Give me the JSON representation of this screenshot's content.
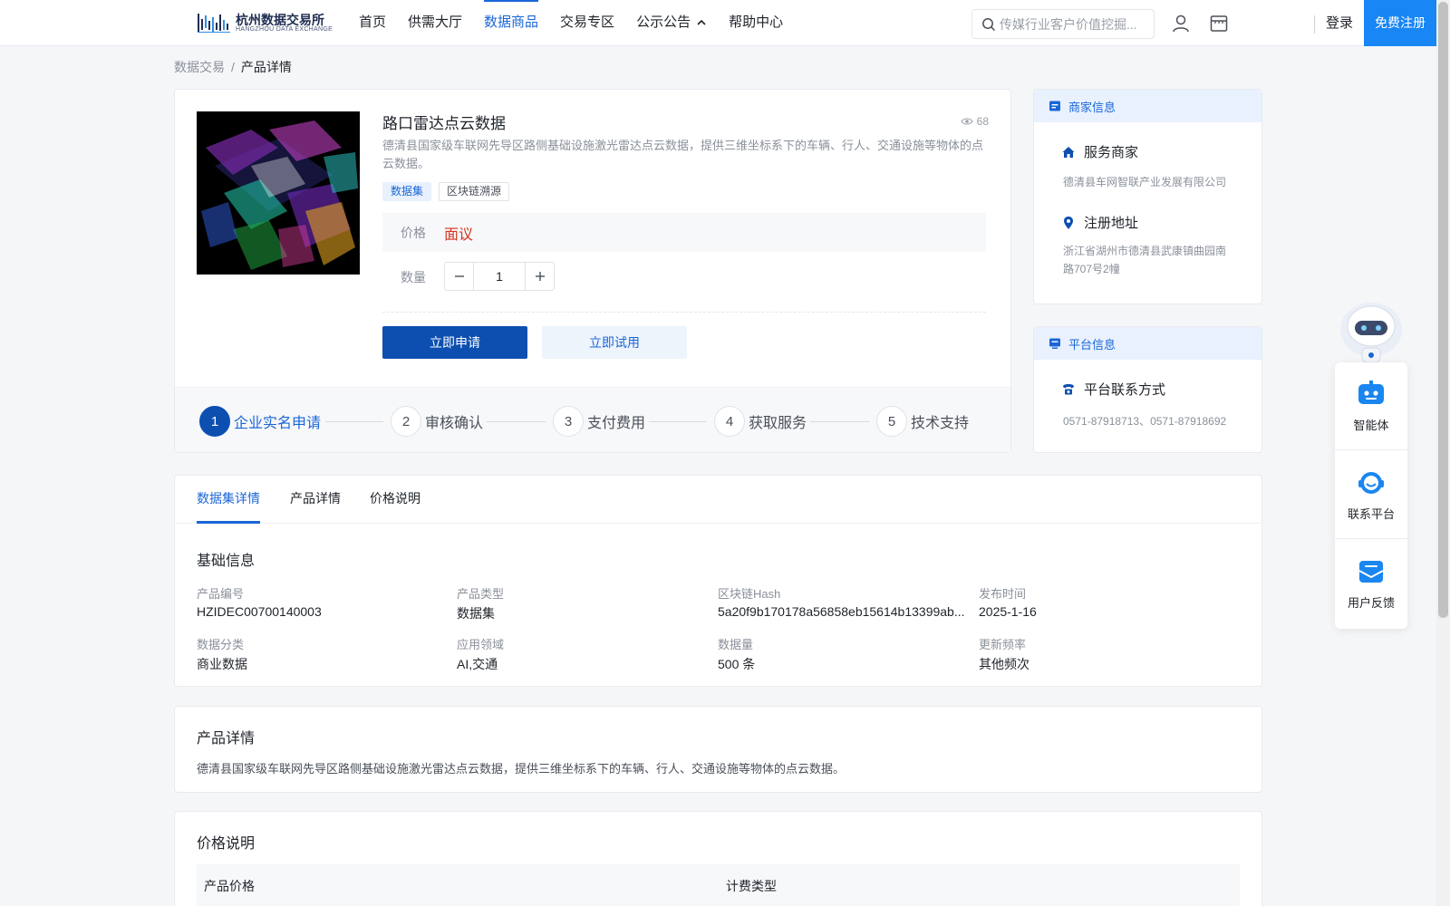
{
  "header": {
    "logo_cn": "杭州数据交易所",
    "logo_en": "HANGZHOU DATA EXCHANGE",
    "nav": [
      {
        "label": "首页"
      },
      {
        "label": "供需大厅"
      },
      {
        "label": "数据商品"
      },
      {
        "label": "交易专区"
      },
      {
        "label": "公示公告"
      },
      {
        "label": "帮助中心"
      }
    ],
    "search_placeholder": "传媒行业客户价值挖掘...",
    "login": "登录",
    "register": "免费注册"
  },
  "breadcrumb": {
    "root": "数据交易",
    "separator": "/",
    "current": "产品详情"
  },
  "product": {
    "title": "路口雷达点云数据",
    "views": "68",
    "description": "德清县国家级车联网先导区路侧基础设施激光雷达点云数据，提供三维坐标系下的车辆、行人、交通设施等物体的点云数据。",
    "tags": [
      "数据集",
      "区块链溯源"
    ],
    "price_label": "价格",
    "price_value": "面议",
    "quantity_label": "数量",
    "quantity": "1",
    "apply_button": "立即申请",
    "trial_button": "立即试用"
  },
  "steps": [
    {
      "num": "1",
      "label": "企业实名申请"
    },
    {
      "num": "2",
      "label": "审核确认"
    },
    {
      "num": "3",
      "label": "支付费用"
    },
    {
      "num": "4",
      "label": "获取服务"
    },
    {
      "num": "5",
      "label": "技术支持"
    }
  ],
  "merchant": {
    "heading": "商家信息",
    "service_title": "服务商家",
    "service_value": "德清县车网智联产业发展有限公司",
    "address_title": "注册地址",
    "address_value": "浙江省湖州市德清县武康镇曲园南路707号2幢"
  },
  "platform": {
    "heading": "平台信息",
    "contact_title": "平台联系方式",
    "contact_value": "0571-87918713、0571-87918692"
  },
  "tabs": [
    {
      "label": "数据集详情"
    },
    {
      "label": "产品详情"
    },
    {
      "label": "价格说明"
    }
  ],
  "basic_info": {
    "title": "基础信息",
    "fields": [
      {
        "label": "产品编号",
        "value": "HZIDEC00700140003"
      },
      {
        "label": "产品类型",
        "value": "数据集"
      },
      {
        "label": "区块链Hash",
        "value": "5a20f9b170178a56858eb15614b13399ab..."
      },
      {
        "label": "发布时间",
        "value": "2025-1-16"
      },
      {
        "label": "数据分类",
        "value": "商业数据"
      },
      {
        "label": "应用领域",
        "value": "AI,交通"
      },
      {
        "label": "数据量",
        "value": "500 条"
      },
      {
        "label": "更新频率",
        "value": "其他频次"
      }
    ]
  },
  "product_detail": {
    "title": "产品详情",
    "text": "德清县国家级车联网先导区路侧基础设施激光雷达点云数据，提供三维坐标系下的车辆、行人、交通设施等物体的点云数据。"
  },
  "price_section": {
    "title": "价格说明",
    "col1": "产品价格",
    "col2": "计费类型"
  },
  "float_panel": [
    {
      "label": "智能体"
    },
    {
      "label": "联系平台"
    },
    {
      "label": "用户反馈"
    }
  ],
  "colors": {
    "accent": "#1a66d8",
    "primary_button": "#0d4fb0",
    "register": "#1886f5",
    "price": "#d4341c"
  }
}
